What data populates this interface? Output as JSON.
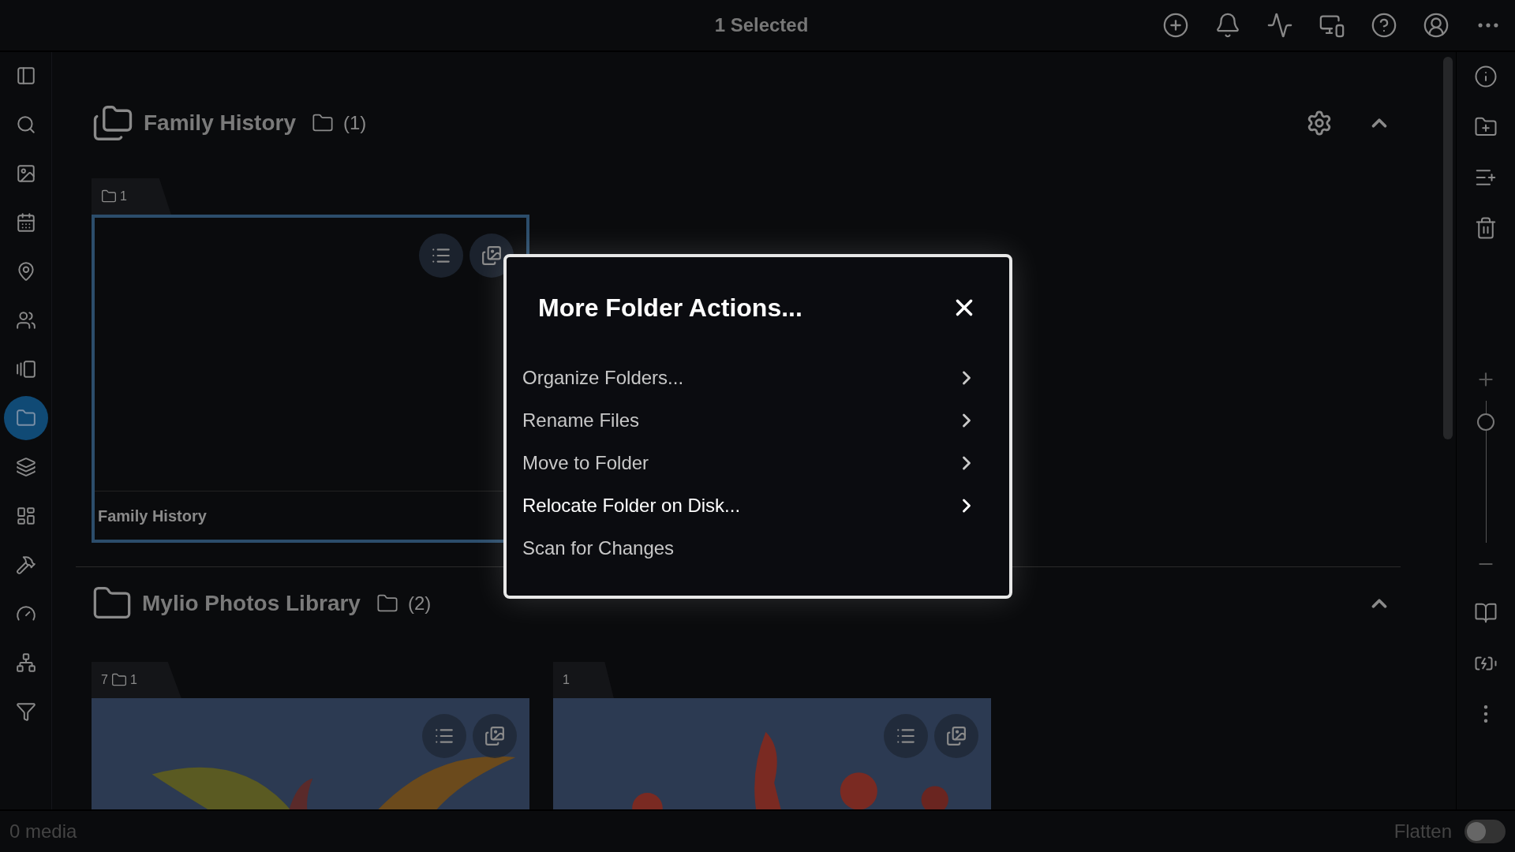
{
  "top_bar": {
    "title": "1 Selected"
  },
  "left_sidebar": {
    "items": [
      {
        "selected": false
      },
      {
        "selected": false
      },
      {
        "selected": false
      },
      {
        "selected": false
      },
      {
        "selected": false
      },
      {
        "selected": false
      },
      {
        "selected": false
      },
      {
        "selected": true
      },
      {
        "selected": false
      },
      {
        "selected": false
      },
      {
        "selected": false
      },
      {
        "selected": false
      },
      {
        "selected": false
      },
      {
        "selected": false
      }
    ]
  },
  "sections": [
    {
      "title": "Family History",
      "count": "(1)",
      "kind": "library",
      "expanded": true,
      "folders": [
        {
          "kind": "empty",
          "counts": [
            "1"
          ],
          "name": "Family History",
          "selected": true
        }
      ]
    },
    {
      "title": "Mylio Photos Library",
      "count": "(2)",
      "kind": "folder",
      "expanded": true,
      "folders": [
        {
          "kind": "picture",
          "media_count": "7",
          "counts": [
            "1"
          ],
          "selected": false
        },
        {
          "kind": "picture",
          "media_count": "1",
          "selected": false
        }
      ]
    }
  ],
  "dialog": {
    "title": "More Folder Actions...",
    "items": [
      {
        "label": "Organize Folders...",
        "kind": "submenu",
        "highlighted": false
      },
      {
        "label": "Rename Files",
        "kind": "submenu",
        "highlighted": false
      },
      {
        "label": "Move to Folder",
        "kind": "submenu",
        "highlighted": false
      },
      {
        "label": "Relocate Folder on Disk...",
        "kind": "submenu",
        "highlighted": true
      },
      {
        "label": "Scan for Changes",
        "kind": "action",
        "highlighted": false
      }
    ]
  },
  "zoom_slider": {
    "level": 0.9
  },
  "status_bar": {
    "media": "0 media",
    "flatten": {
      "label": "Flatten",
      "on": false
    }
  }
}
